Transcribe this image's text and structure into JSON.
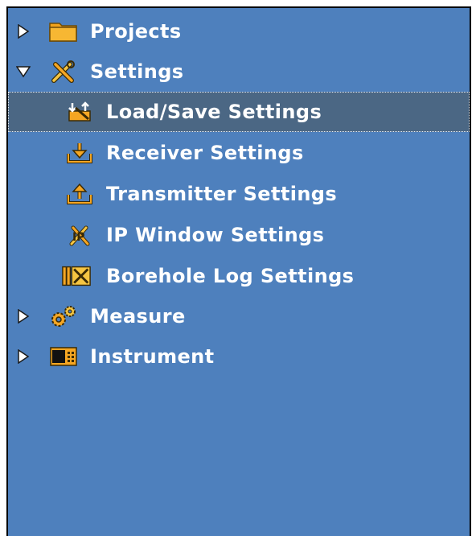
{
  "tree": {
    "projects": {
      "label": "Projects",
      "icon": "folder-icon",
      "expanded": false
    },
    "settings": {
      "label": "Settings",
      "icon": "tools-icon",
      "expanded": true,
      "children": [
        {
          "label": "Load/Save Settings",
          "icon": "load-save-icon",
          "selected": true
        },
        {
          "label": "Receiver Settings",
          "icon": "download-tray-icon"
        },
        {
          "label": "Transmitter Settings",
          "icon": "upload-tray-icon"
        },
        {
          "label": "IP Window Settings",
          "icon": "ip-tools-icon"
        },
        {
          "label": "Borehole Log Settings",
          "icon": "borehole-tools-icon"
        }
      ]
    },
    "measure": {
      "label": "Measure",
      "icon": "gears-icon",
      "expanded": false
    },
    "instrument": {
      "label": "Instrument",
      "icon": "instrument-icon",
      "expanded": false
    }
  },
  "colors": {
    "panel_bg": "#4e80bd",
    "selected_bg": "#4b6784",
    "icon_orange": "#f5a623",
    "text": "#ffffff"
  }
}
